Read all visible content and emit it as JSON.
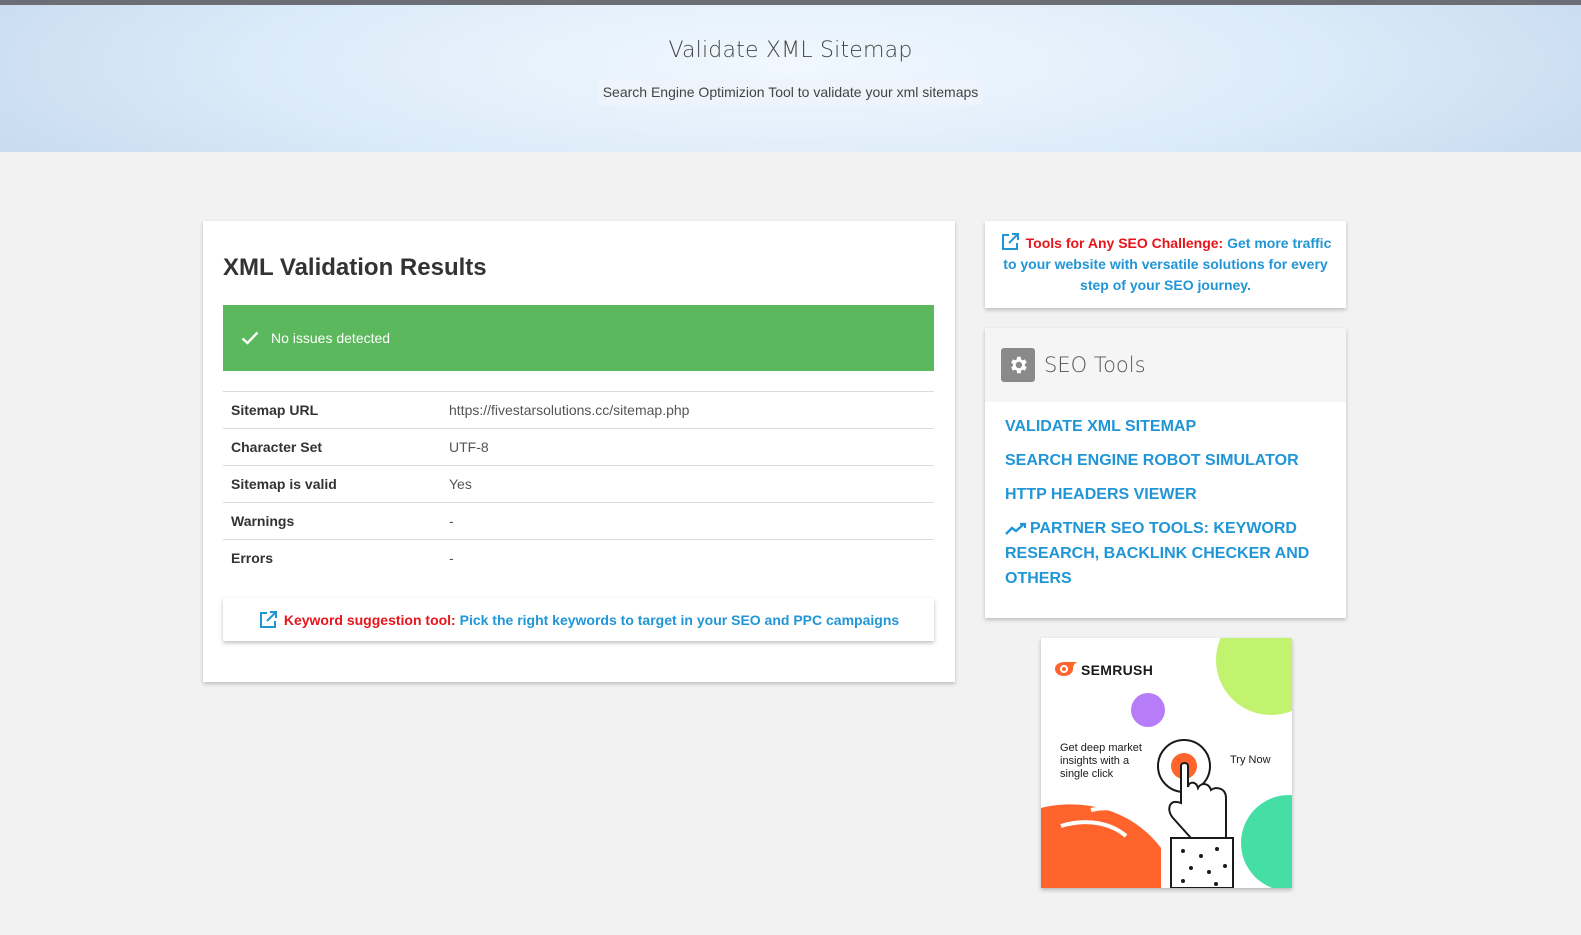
{
  "header": {
    "title": "Validate XML Sitemap",
    "subtitle": "Search Engine Optimizion Tool to validate your xml sitemaps"
  },
  "results": {
    "title": "XML Validation Results",
    "status_message": "No issues detected",
    "rows": [
      {
        "label": "Sitemap URL",
        "value": "https://fivestarsolutions.cc/sitemap.php"
      },
      {
        "label": "Character Set",
        "value": "UTF-8"
      },
      {
        "label": "Sitemap is valid",
        "value": "Yes"
      },
      {
        "label": "Warnings",
        "value": "-"
      },
      {
        "label": "Errors",
        "value": "-"
      }
    ],
    "keyword_promo": {
      "label": "Keyword suggestion tool:",
      "link_text": "Pick the right keywords to target in your SEO and PPC campaigns"
    }
  },
  "sidebar": {
    "promo": {
      "label": "Tools for Any SEO Challenge:",
      "link_text": "Get more traffic to your website with versatile solutions for every step of your SEO journey."
    },
    "seo_tools": {
      "title": "SEO Tools",
      "links": [
        "VALIDATE XML SITEMAP",
        "SEARCH ENGINE ROBOT SIMULATOR",
        "HTTP HEADERS VIEWER",
        "PARTNER SEO TOOLS: KEYWORD RESEARCH, BACKLINK CHECKER AND OTHERS"
      ]
    },
    "ad": {
      "brand": "SEMRUSH",
      "text": "Get deep market insights with a single click",
      "cta": "Try Now"
    }
  },
  "colors": {
    "success": "#5cb85c",
    "link": "#2196d6",
    "highlight": "#e8141b"
  }
}
